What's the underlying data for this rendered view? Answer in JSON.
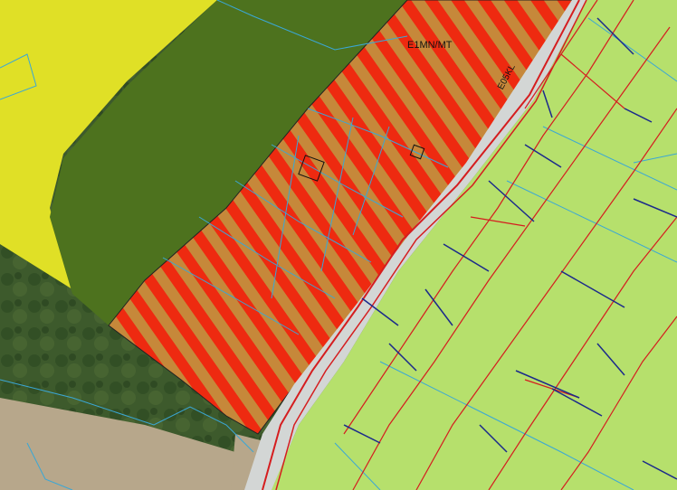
{
  "map": {
    "labels": {
      "zone_code": "E1MN/MT",
      "road_code": "E05KL"
    },
    "colors": {
      "zone_yellow": "#e6e629",
      "forest_green": "#587f22",
      "hatch_red": "#ee2a10",
      "hatch_tan": "#c6883a",
      "agri_green": "#b6e06c",
      "road_grey": "#d3d6d5",
      "parcel_blue": "#3aa7d6",
      "network_red": "#d51d1f",
      "network_navy": "#1b2a8b",
      "aerial_forest": "#3d5a2c",
      "field_tan": "#b7a78b"
    }
  }
}
